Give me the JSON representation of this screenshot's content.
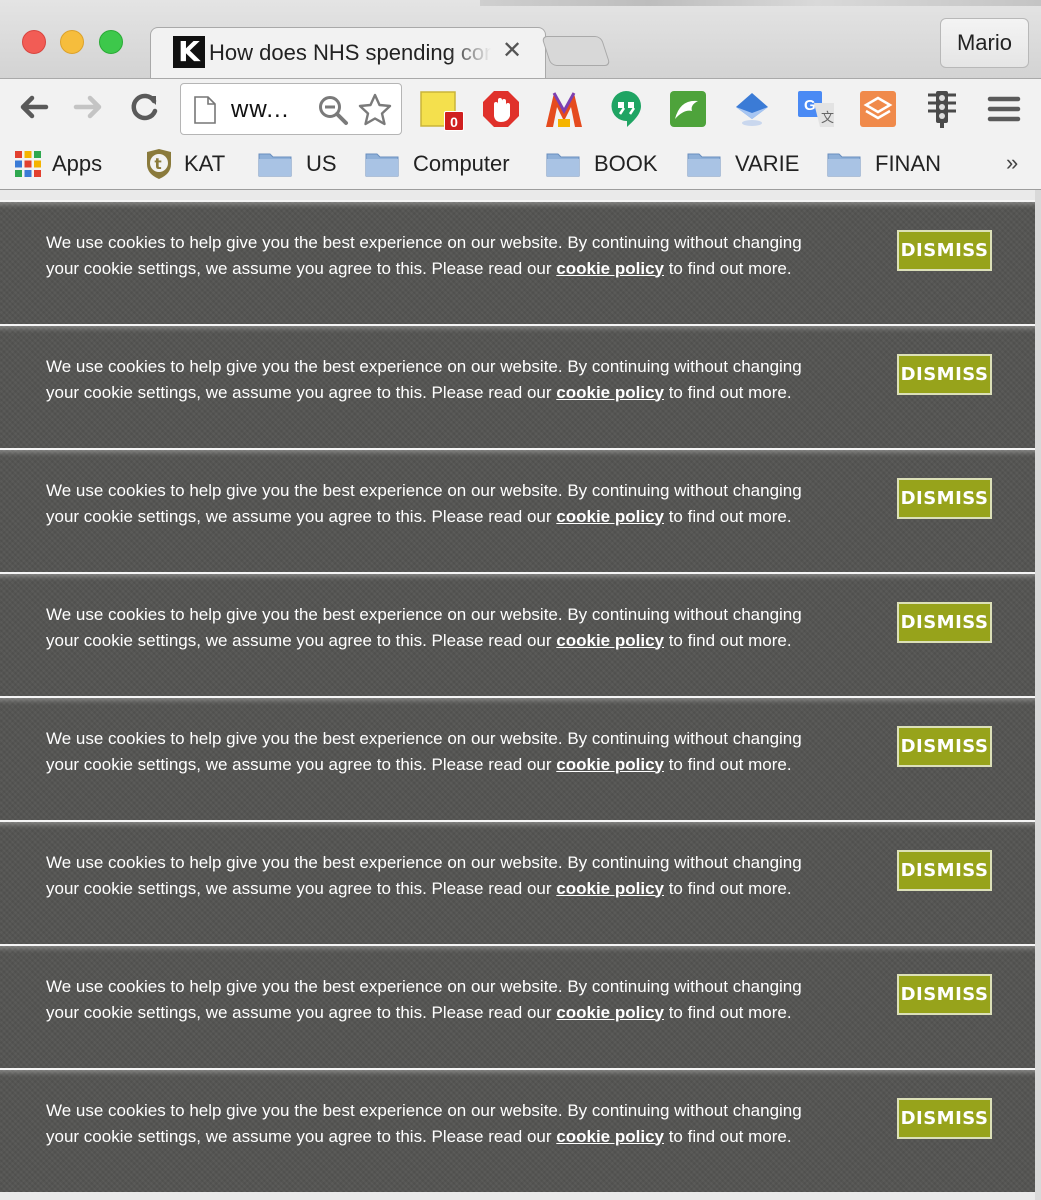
{
  "window": {
    "tab_title": "How does NHS spending compare",
    "tab_favicon_letter": "K",
    "tab_close": "✕",
    "profile_name": "Mario"
  },
  "toolbar": {
    "omnibox_text": "ww...",
    "badge_count": "0",
    "icons": [
      "back-arrow-icon",
      "forward-arrow-icon",
      "reload-icon",
      "page-icon",
      "zoom-icon",
      "bookmark-star-icon",
      "sticky-note-icon",
      "adblock-icon",
      "m-logo-icon",
      "hangouts-icon",
      "evernote-like-icon",
      "bookmark-diamond-icon",
      "translate-icon",
      "layers-icon",
      "traffic-light-icon",
      "menu-icon"
    ]
  },
  "bookmarks": {
    "items": [
      {
        "label": "Apps",
        "icon": "apps-grid-icon"
      },
      {
        "label": "KAT",
        "icon": "kat-shield-icon"
      },
      {
        "label": "US",
        "icon": "folder-icon"
      },
      {
        "label": "Computer",
        "icon": "folder-icon"
      },
      {
        "label": "BOOK",
        "icon": "folder-icon"
      },
      {
        "label": "VARIE",
        "icon": "folder-icon"
      },
      {
        "label": "FINAN",
        "icon": "folder-icon"
      }
    ],
    "more": "»"
  },
  "cookie_banner": {
    "text_before": "We use cookies to help give you the best experience on our website. By continuing without changing your cookie settings, we assume you agree to this. Please read our ",
    "link_text": "cookie policy",
    "text_after": " to find out more.",
    "dismiss_label": "DISMISS",
    "repeat_count_visible": 8
  },
  "colors": {
    "banner_bg": "#555553",
    "dismiss_bg": "#97a31b",
    "dismiss_border": "#dce0b8"
  }
}
